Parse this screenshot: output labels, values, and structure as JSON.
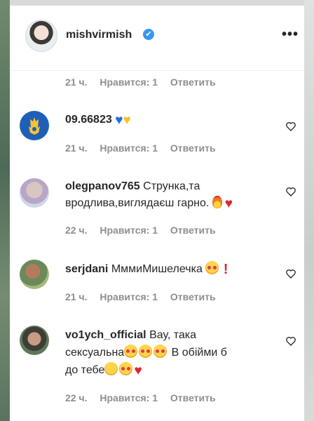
{
  "header": {
    "username": "mishvirmish",
    "verified_glyph": "✔",
    "more_glyph": "•••"
  },
  "meta_labels": {
    "likes": "Нравится: 1",
    "reply": "Ответить"
  },
  "first_meta": {
    "time": "21 ч."
  },
  "comments": [
    {
      "username": "09.66823",
      "text": "",
      "time": "21 ч.",
      "avatar_icon": "ukraine-trident-avatar"
    },
    {
      "username": "olegpanov765",
      "text": "Струнка,та вродлива,виглядаєш гарно.",
      "time": "22 ч.",
      "avatar_icon": "user-photo-avatar"
    },
    {
      "username": "serjdani",
      "text": "МммиМишелечка",
      "time": "21 ч.",
      "avatar_icon": "user-photo-avatar"
    },
    {
      "username": "vo1ych_official",
      "text_line1": "Вау, така",
      "text_line2": "сексуальна",
      "text_line3": "В обійми б",
      "text_line4": "до тебе",
      "time": "22 ч.",
      "avatar_icon": "user-photo-avatar"
    }
  ],
  "colors": {
    "verified": "#3897f0",
    "meta_text": "#8e8e8e",
    "text": "#262626"
  }
}
